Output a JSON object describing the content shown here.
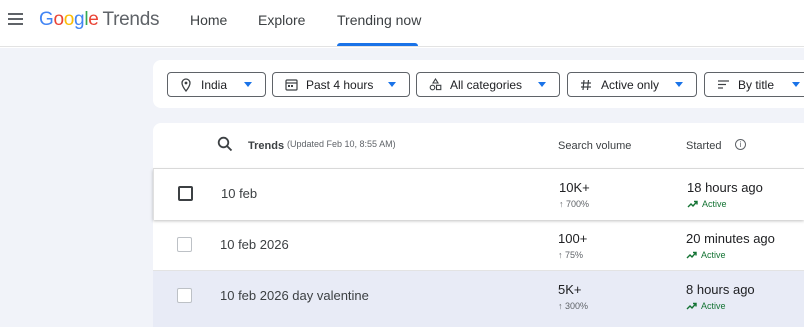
{
  "header": {
    "logo_google": [
      "G",
      "o",
      "o",
      "g",
      "l",
      "e"
    ],
    "logo_colors": [
      "#4285F4",
      "#EA4335",
      "#FBBC05",
      "#4285F4",
      "#34A853",
      "#EA4335"
    ],
    "logo_trends": "Trends",
    "nav": [
      {
        "label": "Home"
      },
      {
        "label": "Explore"
      },
      {
        "label": "Trending now",
        "active": true
      }
    ]
  },
  "filters": [
    {
      "label": "India",
      "icon": "location-pin-icon"
    },
    {
      "label": "Past 4 hours",
      "icon": "calendar-icon"
    },
    {
      "label": "All categories",
      "icon": "categories-icon"
    },
    {
      "label": "Active only",
      "icon": "hashtag-icon"
    },
    {
      "label": "By title",
      "icon": "sort-icon"
    }
  ],
  "table": {
    "header": {
      "trends": "Trends",
      "updated": "(Updated Feb 10, 8:55 AM)",
      "search_volume": "Search volume",
      "started": "Started"
    },
    "rows": [
      {
        "term": "10 feb",
        "volume": "10K+",
        "growth": "↑ 700%",
        "started": "18 hours ago",
        "status": "Active"
      },
      {
        "term": "10 feb 2026",
        "volume": "100+",
        "growth": "↑ 75%",
        "started": "20 minutes ago",
        "status": "Active"
      },
      {
        "term": "10 feb 2026 day valentine",
        "volume": "5K+",
        "growth": "↑ 300%",
        "started": "8 hours ago",
        "status": "Active"
      }
    ]
  },
  "colors": {
    "accent": "#1a73e8",
    "active_green": "#137333",
    "background": "#f1f3f9",
    "row_highlight": "#e8ebf6"
  }
}
